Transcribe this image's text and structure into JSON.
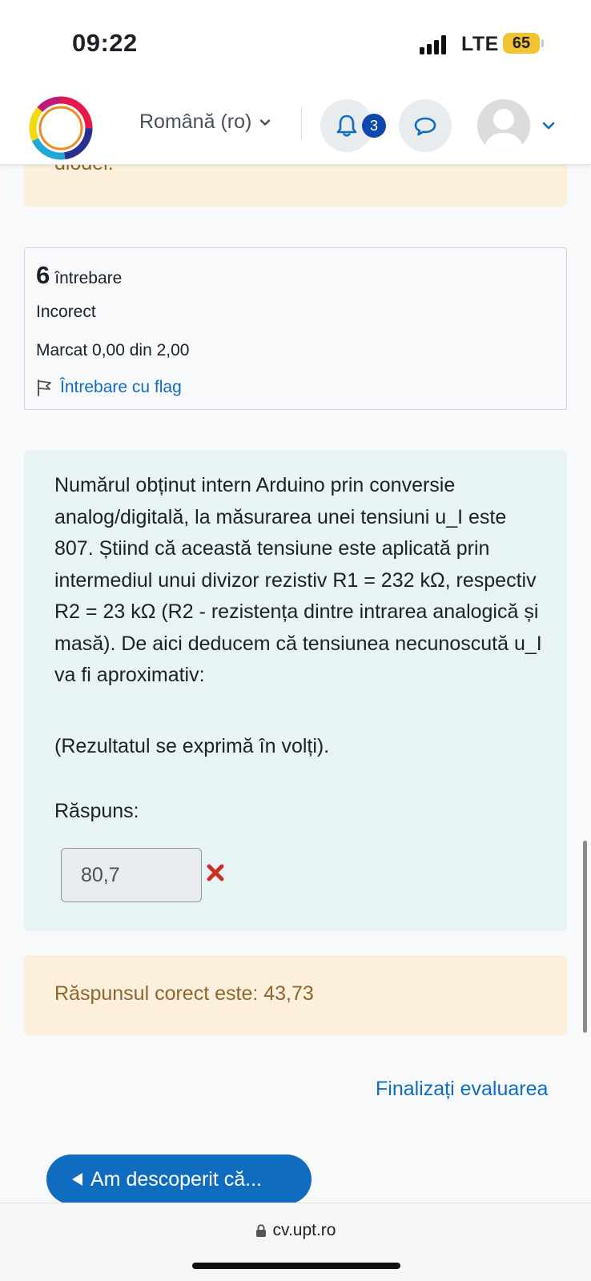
{
  "status_bar": {
    "time": "09:22",
    "network": "LTE",
    "battery": "65"
  },
  "navbar": {
    "language": "Română (ro)",
    "notification_count": "3"
  },
  "previous_feedback_fragment": "diodei.",
  "question": {
    "number": "6",
    "number_label": "întrebare",
    "state": "Incorect",
    "grade": "Marcat 0,00 din 2,00",
    "flag_label": "Întrebare cu flag",
    "text": "Numărul obținut intern Arduino prin conversie analog/digitală, la măsurarea unei tensiuni u_I este 807. Știind că această tensiune este aplicată prin intermediul unui divizor rezistiv R1 =  232 kΩ, respectiv R2 = 23 kΩ (R2 - rezistența dintre intrarea analogică și masă). De aici deducem că tensiunea necunoscută u_I va fi aproximativ:",
    "hint": "(Rezultatul se exprimă în volți).",
    "answer_label": "Răspuns:",
    "answer_value": "80,7",
    "correct_answer": "Răspunsul corect este: 43,73"
  },
  "navigation": {
    "finish_review": "Finalizați evaluarea",
    "previous_activity": "Am descoperit că..."
  },
  "browser": {
    "url": "cv.upt.ro"
  },
  "colors": {
    "link_blue": "#0f6cbf",
    "badge_blue": "#0f47ad",
    "formulation_bg": "#e7f3f5",
    "feedback_bg": "#fcefdc",
    "feedback_text": "#8e662e",
    "incorrect_red": "#ca3120"
  }
}
